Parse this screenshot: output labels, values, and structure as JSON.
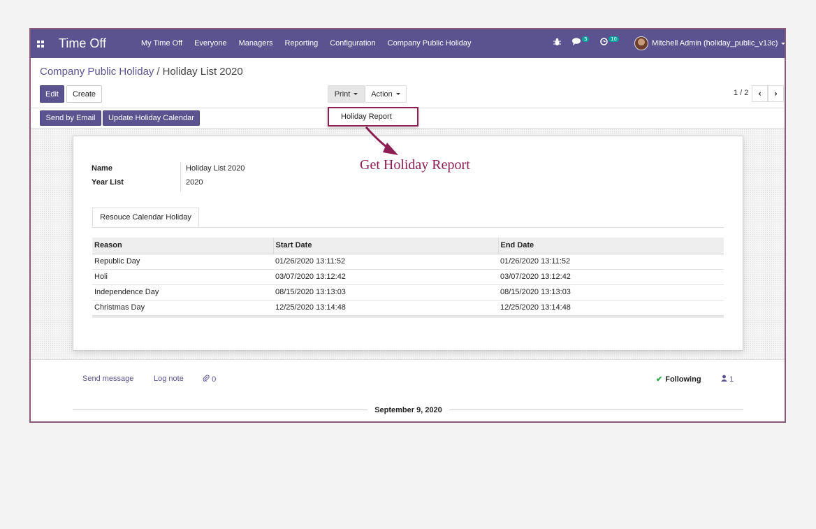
{
  "navbar": {
    "app_title": "Time Off",
    "menu": [
      "My Time Off",
      "Everyone",
      "Managers",
      "Reporting",
      "Configuration",
      "Company Public Holiday"
    ],
    "messages_count": "3",
    "activities_count": "10",
    "user": "Mitchell Admin (holiday_public_v13c)",
    "bg_color": "#5a5390"
  },
  "breadcrumb": {
    "parent": "Company Public Holiday",
    "separator": "/",
    "current": "Holiday List 2020"
  },
  "controls": {
    "edit": "Edit",
    "create": "Create",
    "print": "Print",
    "action": "Action",
    "pager": "1 / 2",
    "prev": "‹",
    "next": "›"
  },
  "statusbar": {
    "send_email": "Send by Email",
    "update_calendar": "Update Holiday Calendar"
  },
  "print_menu": {
    "item": "Holiday Report"
  },
  "annotation": "Get Holiday Report",
  "form": {
    "name_label": "Name",
    "name_value": "Holiday List 2020",
    "year_label": "Year List",
    "year_value": "2020",
    "tab_label": "Resouce Calendar Holiday",
    "columns": [
      "Reason",
      "Start Date",
      "End Date"
    ],
    "rows": [
      [
        "Republic Day",
        "01/26/2020 13:11:52",
        "01/26/2020 13:11:52"
      ],
      [
        "Holi",
        "03/07/2020 13:12:42",
        "03/07/2020 13:12:42"
      ],
      [
        "Independence Day",
        "08/15/2020 13:13:03",
        "08/15/2020 13:13:03"
      ],
      [
        "Christmas Day",
        "12/25/2020 13:14:48",
        "12/25/2020 13:14:48"
      ]
    ]
  },
  "chatter": {
    "send_message": "Send message",
    "log_note": "Log note",
    "attachments": "0",
    "following": "Following",
    "followers": "1",
    "date": "September 9, 2020"
  },
  "colors": {
    "accent": "#5a5390",
    "highlight": "#8c1e53"
  }
}
